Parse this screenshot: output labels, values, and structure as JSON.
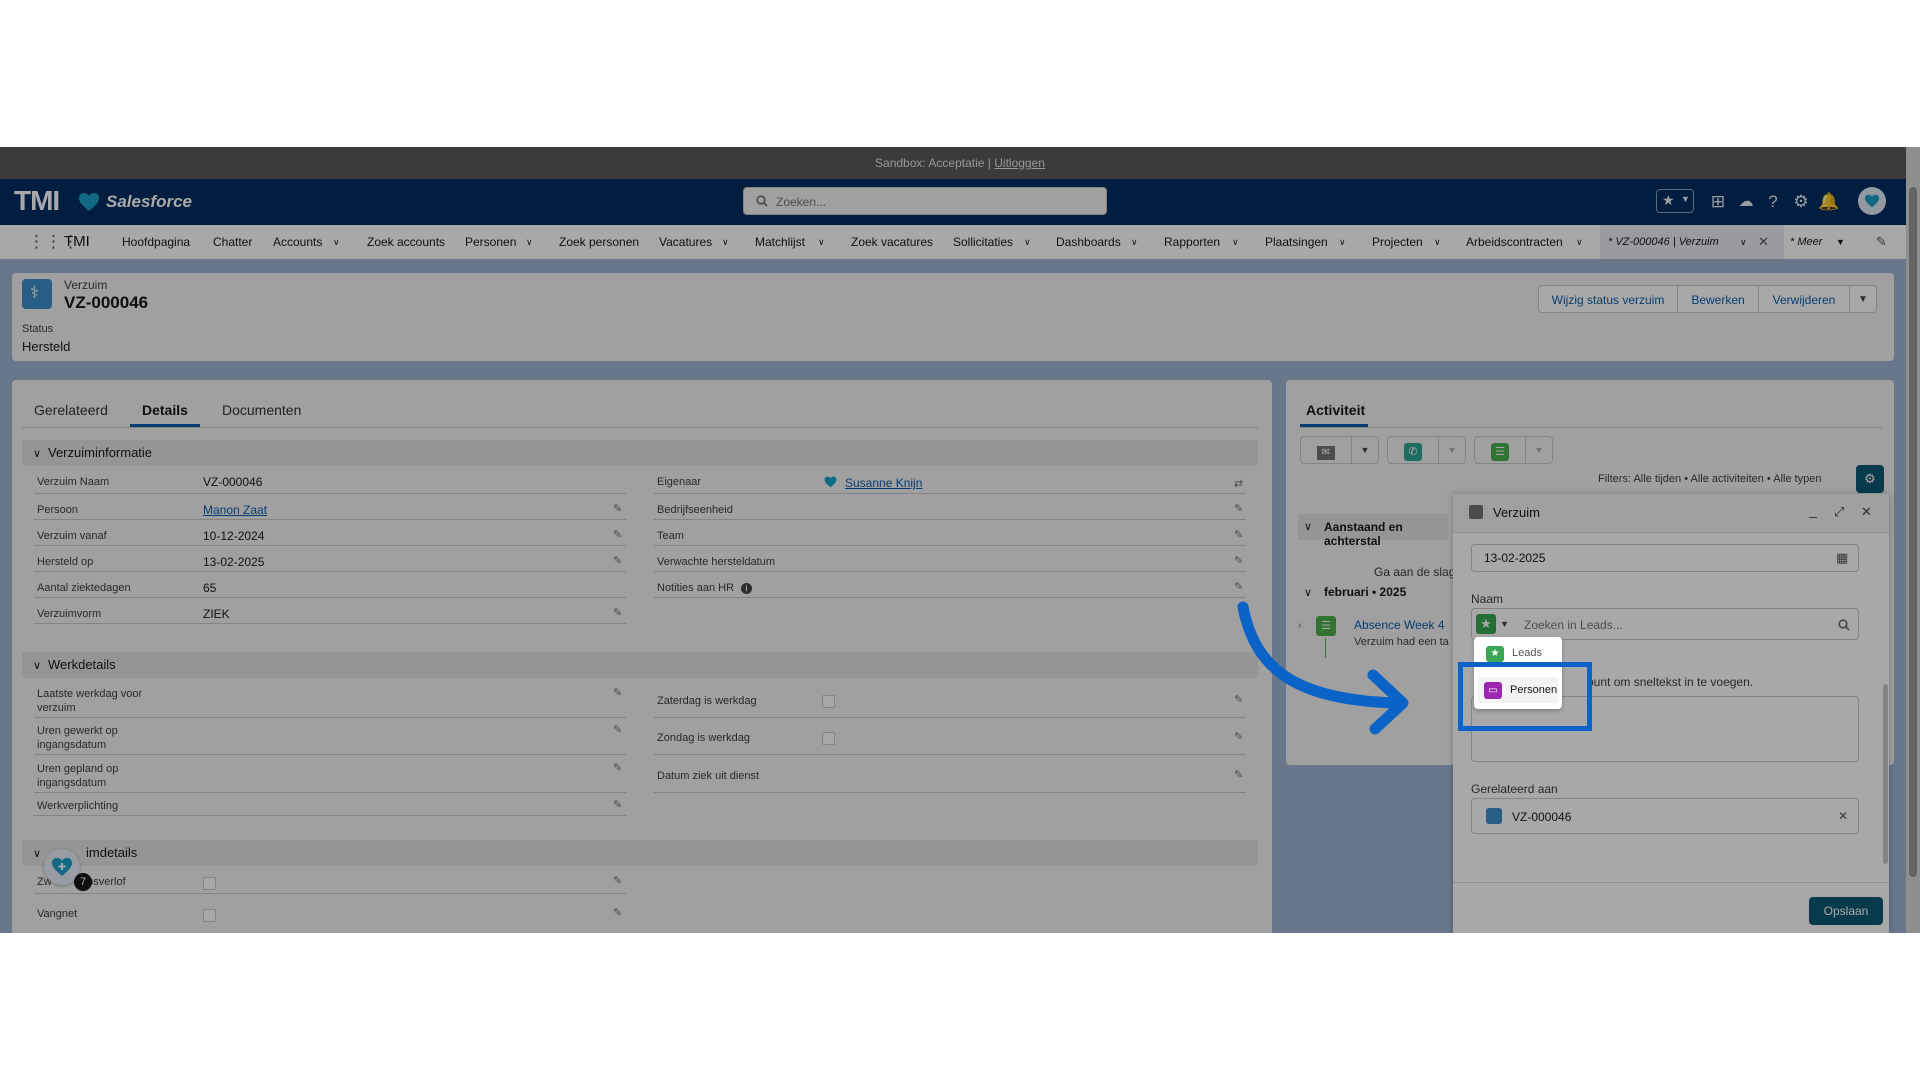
{
  "sandbox": {
    "text": "Sandbox: Acceptatie |",
    "logout": "Uitloggen"
  },
  "header": {
    "logo_tmi": "TMI",
    "logo_salesforce": "Salesforce",
    "search_placeholder": "Zoeken..."
  },
  "nav": {
    "app_name": "TMI",
    "items": [
      "Hoofdpagina",
      "Chatter",
      "Accounts",
      "Zoek accounts",
      "Personen",
      "Zoek personen",
      "Vacatures",
      "Matchlijst",
      "Zoek vacatures",
      "Sollicitaties",
      "Dashboards",
      "Rapporten",
      "Plaatsingen",
      "Projecten",
      "Arbeidscontracten"
    ],
    "active_tab": "* VZ-000046 | Verzuim",
    "more": "* Meer"
  },
  "record": {
    "object": "Verzuim",
    "name": "VZ-000046",
    "status_label": "Status",
    "status_value": "Hersteld",
    "buttons": [
      "Wijzig status verzuim",
      "Bewerken",
      "Verwijderen"
    ]
  },
  "tabs": [
    "Gerelateerd",
    "Details",
    "Documenten"
  ],
  "sections": {
    "info": "Verzuiminformatie",
    "work": "Werkdetails",
    "third_partial": "imdetails"
  },
  "fields": {
    "naam_label": "Verzuim Naam",
    "naam_value": "VZ-000046",
    "persoon_label": "Persoon",
    "persoon_value": "Manon Zaat",
    "vanaf_label": "Verzuim vanaf",
    "vanaf_value": "10-12-2024",
    "hersteld_label": "Hersteld op",
    "hersteld_value": "13-02-2025",
    "dagen_label": "Aantal ziektedagen",
    "dagen_value": "65",
    "vorm_label": "Verzuimvorm",
    "vorm_value": "ZIEK",
    "eigenaar_label": "Eigenaar",
    "eigenaar_value": "Susanne Knijn",
    "bedrijf_label": "Bedrijfseenheid",
    "team_label": "Team",
    "verwacht_label": "Verwachte hersteldatum",
    "notities_label": "Notities aan HR",
    "laatste_l1": "Laatste werkdag voor",
    "laatste_l2": "verzuim",
    "gewerkt_l1": "Uren gewerkt op",
    "gewerkt_l2": "ingangsdatum",
    "gepland_l1": "Uren gepland op",
    "gepland_l2": "ingangsdatum",
    "verplichting_label": "Werkverplichting",
    "zaterdag_label": "Zaterdag is werkdag",
    "zondag_label": "Zondag is werkdag",
    "ziek_uit_dienst_label": "Datum ziek uit dienst",
    "verlof_partial": "Zw",
    "verlof_label": "apsverlof",
    "vangnet_label": "Vangnet"
  },
  "utility": {
    "badge": "7"
  },
  "activity": {
    "title": "Activiteit",
    "filters": "Filters: Alle tijden • Alle activiteiten • Alle typen",
    "upcoming": "Aanstaand en achterstal",
    "get_started": "Ga aan de slag",
    "month": "februari • 2025",
    "item_title": "Absence Week 4",
    "item_sub": "Verzuim had een ta"
  },
  "modal": {
    "title": "Verzuim",
    "date": "13-02-2025",
    "name_label": "Naam",
    "search_placeholder": "Zoeken in Leads...",
    "hint": "punt om sneltekst in te voegen.",
    "related_label": "Gerelateerd aan",
    "related_value": "VZ-000046",
    "save": "Opslaan"
  },
  "dropdown": {
    "options": [
      "Leads",
      "Personen"
    ]
  },
  "colors": {
    "brand_navy": "#032d60",
    "link": "#0b5cab",
    "highlight": "#0a63c7",
    "save_button": "#0b5a74"
  }
}
